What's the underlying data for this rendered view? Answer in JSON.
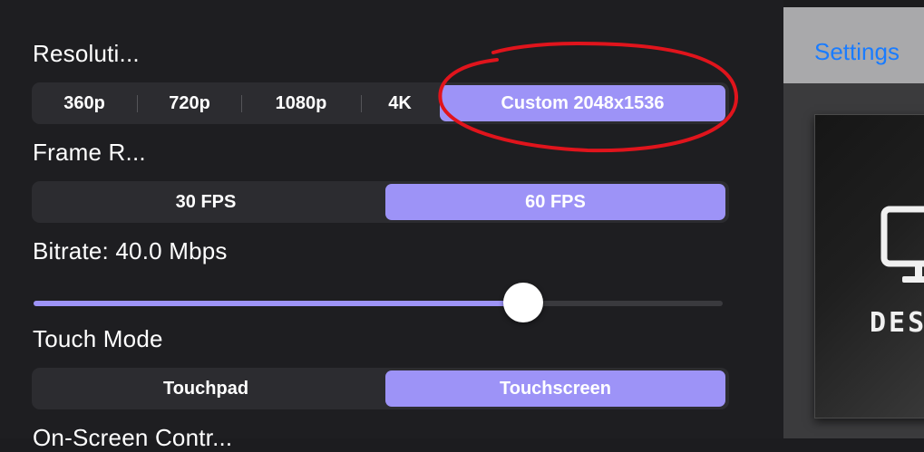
{
  "resolution": {
    "label": "Resoluti...",
    "options": [
      "360p",
      "720p",
      "1080p",
      "4K",
      "Custom 2048x1536"
    ],
    "selected": "Custom 2048x1536"
  },
  "frame_rate": {
    "label": "Frame R...",
    "options": [
      "30 FPS",
      "60 FPS"
    ],
    "selected": "60 FPS"
  },
  "bitrate": {
    "label": "Bitrate: 40.0 Mbps",
    "slider_fraction": 0.71
  },
  "touch_mode": {
    "label": "Touch Mode",
    "options": [
      "Touchpad",
      "Touchscreen"
    ],
    "selected": "Touchscreen"
  },
  "next_section": {
    "label": "On-Screen Contr..."
  },
  "right_pane": {
    "nav_link": "Settings",
    "card_title": "DESI",
    "card_icon": "monitor-icon"
  },
  "colors": {
    "accent": "#9d93f7",
    "annotation": "#e0141c",
    "link": "#1a7cff"
  }
}
